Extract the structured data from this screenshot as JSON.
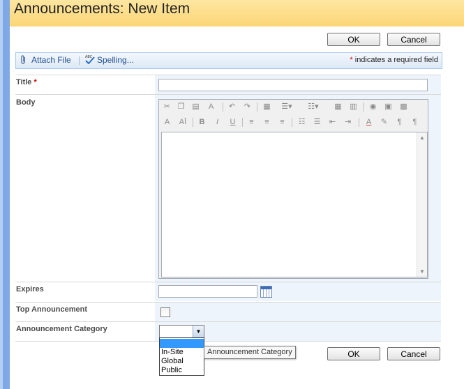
{
  "page": {
    "title": "Announcements: New Item"
  },
  "buttons": {
    "ok": "OK",
    "cancel": "Cancel"
  },
  "toolbar": {
    "attach_file": "Attach File",
    "spelling": "Spelling...",
    "required_star": "*",
    "required_note": "indicates a required field"
  },
  "fields": {
    "title": {
      "label": "Title",
      "required_star": "*",
      "value": ""
    },
    "body": {
      "label": "Body"
    },
    "expires": {
      "label": "Expires",
      "value": ""
    },
    "top_announcement": {
      "label": "Top Announcement",
      "checked": false
    },
    "category": {
      "label": "Announcement Category",
      "selected": "",
      "options": [
        "",
        "In-Site",
        "Global",
        "Public"
      ],
      "tooltip": "Announcement Category"
    }
  },
  "rte_icons": {
    "row1": [
      "cut-icon",
      "copy-icon",
      "paste-icon",
      "format-painter-icon",
      "undo-icon",
      "redo-icon",
      "table-icon",
      "bulleted-list-dropdown-icon",
      "insert-dropdown-icon",
      "grid-icon",
      "grid2-icon",
      "web-link-icon",
      "image-icon",
      "zoom-icon"
    ],
    "row2": [
      "font-size-icon",
      "font-icon",
      "bold-icon",
      "italic-icon",
      "underline-icon",
      "align-left-icon",
      "align-center-icon",
      "align-right-icon",
      "numbered-list-icon",
      "bulleted-list-icon",
      "decrease-indent-icon",
      "increase-indent-icon",
      "font-color-icon",
      "highlight-icon",
      "ltr-icon",
      "rtl-icon"
    ]
  },
  "colors": {
    "title_bar": "#fbd677",
    "required": "#cc0000",
    "dropdown_highlight": "#3399ff"
  }
}
